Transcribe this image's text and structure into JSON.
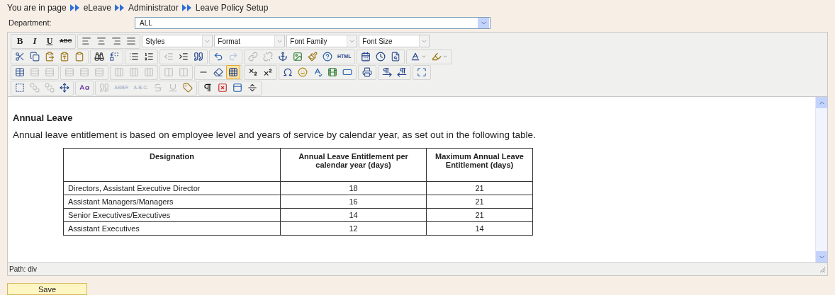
{
  "breadcrumb": [
    "You are in page",
    "eLeave",
    "Administrator",
    "Leave Policy Setup"
  ],
  "department": {
    "label": "Department:",
    "value": "ALL"
  },
  "toolbar": {
    "rows": [
      [
        {
          "kind": "buttons",
          "buttons": [
            {
              "label": "B",
              "disabled": false,
              "on": false
            },
            {
              "label": "I",
              "disabled": false,
              "on": false
            },
            {
              "label": "U",
              "disabled": false,
              "on": false
            },
            {
              "label": "ABC",
              "disabled": false,
              "on": false
            }
          ]
        },
        {
          "kind": "buttons",
          "buttons": [
            {
              "disabled": false,
              "on": false
            },
            {
              "disabled": false,
              "on": false
            },
            {
              "disabled": false,
              "on": false
            },
            {
              "disabled": false,
              "on": false
            }
          ]
        },
        {
          "kind": "dropdown",
          "label": "Styles"
        },
        {
          "kind": "dropdown",
          "label": "Format"
        },
        {
          "kind": "dropdown",
          "label": "Font Family"
        },
        {
          "kind": "dropdown",
          "label": "Font Size"
        }
      ],
      [
        {
          "kind": "buttons",
          "buttons": [
            {
              "disabled": false,
              "on": false
            },
            {
              "disabled": false,
              "on": false
            },
            {
              "disabled": false,
              "on": false
            },
            {
              "disabled": false,
              "on": false
            },
            {
              "disabled": false,
              "on": false
            }
          ]
        },
        {
          "kind": "buttons",
          "buttons": [
            {
              "disabled": false,
              "on": false
            },
            {
              "disabled": false,
              "on": false
            }
          ]
        },
        {
          "kind": "buttons",
          "buttons": [
            {
              "disabled": false,
              "on": false
            },
            {
              "disabled": false,
              "on": false
            }
          ]
        },
        {
          "kind": "buttons",
          "buttons": [
            {
              "disabled": true,
              "on": false
            },
            {
              "disabled": false,
              "on": false
            },
            {
              "disabled": false,
              "on": false
            }
          ]
        },
        {
          "kind": "buttons",
          "buttons": [
            {
              "disabled": false,
              "on": false
            },
            {
              "disabled": true,
              "on": false
            }
          ]
        },
        {
          "kind": "buttons",
          "buttons": [
            {
              "disabled": true,
              "on": false
            },
            {
              "disabled": true,
              "on": false
            },
            {
              "disabled": false,
              "on": false
            },
            {
              "disabled": false,
              "on": false
            },
            {
              "disabled": false,
              "on": false
            },
            {
              "disabled": false,
              "on": false
            },
            {
              "label": "HTML",
              "disabled": false,
              "on": false
            }
          ]
        },
        {
          "kind": "buttons",
          "buttons": [
            {
              "disabled": false,
              "on": false
            },
            {
              "disabled": false,
              "on": false
            },
            {
              "disabled": false,
              "on": false
            }
          ]
        },
        {
          "kind": "buttons",
          "buttons": [
            {
              "disabled": false,
              "on": false,
              "split": true
            },
            {
              "disabled": false,
              "on": false,
              "split": true
            }
          ]
        }
      ],
      [
        {
          "kind": "buttons",
          "buttons": [
            {
              "disabled": false,
              "on": false
            },
            {
              "disabled": true,
              "on": false
            },
            {
              "disabled": true,
              "on": false
            }
          ]
        },
        {
          "kind": "buttons",
          "buttons": [
            {
              "disabled": true,
              "on": false
            },
            {
              "disabled": true,
              "on": false
            },
            {
              "disabled": true,
              "on": false
            }
          ]
        },
        {
          "kind": "buttons",
          "buttons": [
            {
              "disabled": true,
              "on": false
            },
            {
              "disabled": true,
              "on": false
            },
            {
              "disabled": true,
              "on": false
            }
          ]
        },
        {
          "kind": "buttons",
          "buttons": [
            {
              "disabled": true,
              "on": false
            },
            {
              "disabled": true,
              "on": false
            }
          ]
        },
        {
          "kind": "buttons",
          "buttons": [
            {
              "disabled": false,
              "on": false
            },
            {
              "disabled": false,
              "on": false
            },
            {
              "disabled": false,
              "on": true
            }
          ]
        },
        {
          "kind": "buttons",
          "buttons": [
            {
              "disabled": false,
              "on": false
            },
            {
              "disabled": false,
              "on": false
            }
          ]
        },
        {
          "kind": "buttons",
          "buttons": [
            {
              "disabled": false,
              "on": false
            },
            {
              "disabled": false,
              "on": false
            },
            {
              "disabled": false,
              "on": false
            },
            {
              "disabled": false,
              "on": false
            },
            {
              "disabled": false,
              "on": false
            }
          ]
        },
        {
          "kind": "buttons",
          "buttons": [
            {
              "disabled": false,
              "on": false
            }
          ]
        },
        {
          "kind": "buttons",
          "buttons": [
            {
              "disabled": false,
              "on": false
            },
            {
              "disabled": false,
              "on": false
            }
          ]
        },
        {
          "kind": "buttons",
          "buttons": [
            {
              "disabled": false,
              "on": false
            }
          ]
        }
      ],
      [
        {
          "kind": "buttons",
          "buttons": [
            {
              "disabled": false,
              "on": false
            },
            {
              "disabled": true,
              "on": false
            },
            {
              "disabled": true,
              "on": false
            },
            {
              "disabled": false,
              "on": false
            }
          ]
        },
        {
          "kind": "buttons",
          "buttons": [
            {
              "disabled": false,
              "on": false
            }
          ]
        },
        {
          "kind": "buttons",
          "buttons": [
            {
              "disabled": true,
              "on": false
            },
            {
              "label": "ABBR",
              "disabled": true,
              "on": false
            },
            {
              "label": "A.B.C.",
              "disabled": true,
              "on": false
            },
            {
              "disabled": true,
              "on": false
            },
            {
              "disabled": true,
              "on": false
            },
            {
              "disabled": false,
              "on": false
            }
          ]
        },
        {
          "kind": "buttons",
          "buttons": [
            {
              "disabled": false,
              "on": false
            },
            {
              "disabled": false,
              "on": false
            },
            {
              "disabled": false,
              "on": false
            },
            {
              "disabled": false,
              "on": false
            }
          ]
        }
      ]
    ]
  },
  "content": {
    "heading": "Annual Leave",
    "paragraph": "Annual leave entitlement is based on employee level and years of service by calendar year, as set out in the following table.",
    "table": {
      "columns": [
        "Designation",
        "Annual Leave Entitlement per calendar year (days)",
        "Maximum Annual Leave Entitlement (days)"
      ],
      "rows": [
        [
          "Directors, Assistant Executive Director",
          "18",
          "21"
        ],
        [
          "Assistant Managers/Managers",
          "16",
          "21"
        ],
        [
          "Senior Executives/Executives",
          "14",
          "21"
        ],
        [
          "Assistant Executives",
          "12",
          "14"
        ]
      ]
    }
  },
  "path": "Path: div",
  "save": "Save"
}
